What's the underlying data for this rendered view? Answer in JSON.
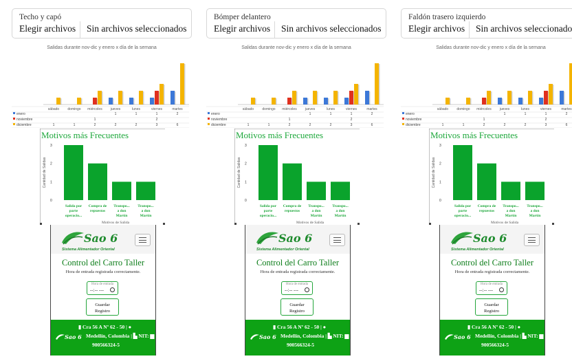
{
  "panels": [
    {
      "upload_label": "Techo y capó",
      "upload_button": "Elegir archivos",
      "upload_status": "Sin archivos seleccionados"
    },
    {
      "upload_label": "Bómper delantero",
      "upload_button": "Elegir archivos",
      "upload_status": "Sin archivos seleccionados"
    },
    {
      "upload_label": "Faldón trasero izquierdo",
      "upload_button": "Elegir archivos",
      "upload_status": "Sin archivos seleccionados"
    }
  ],
  "chart_data": [
    {
      "type": "bar",
      "title": "Salidas durante nov-dic y enero x día de la semana",
      "categories": [
        "sábado",
        "domingo",
        "miércoles",
        "jueves",
        "lunes",
        "viernes",
        "martes"
      ],
      "series": [
        {
          "name": "enero",
          "color": "#3c78d8",
          "values": [
            0,
            0,
            0,
            1,
            1,
            1,
            2
          ]
        },
        {
          "name": "noviembre",
          "color": "#e0301e",
          "values": [
            0,
            0,
            1,
            0,
            0,
            2,
            0
          ]
        },
        {
          "name": "diciembre",
          "color": "#f4b400",
          "values": [
            1,
            1,
            2,
            2,
            2,
            3,
            6
          ]
        }
      ],
      "table": [
        [
          "",
          "",
          "",
          "1",
          "1",
          "1",
          "2"
        ],
        [
          "",
          "",
          "1",
          "",
          "",
          "2",
          ""
        ],
        [
          "1",
          "1",
          "2",
          "2",
          "2",
          "3",
          "6"
        ]
      ],
      "ylim": [
        0,
        6
      ]
    },
    {
      "type": "bar",
      "title": "Motivos más Frecuentes",
      "xlabel": "Motivos de Salida",
      "ylabel": "Cantidad de Salidas",
      "categories": [
        [
          "Salida por",
          "parte",
          "operacio..."
        ],
        [
          "Compra de",
          "repuestos"
        ],
        [
          "Transpo...",
          "a don",
          "Martín"
        ],
        [
          "Transpo...",
          "a don",
          "Martín"
        ]
      ],
      "values": [
        3,
        2,
        1,
        1
      ],
      "yticks": [
        "0",
        "1",
        "2",
        "3"
      ],
      "ylim": [
        0,
        3
      ],
      "color": "#0aa32c"
    }
  ],
  "mobile": {
    "title": "Control del Carro Taller",
    "message": "Hora de entrada registrada correctamente.",
    "time_label": "Hora de entrada",
    "time_value": "--:-- ---",
    "save_line1": "Guardar",
    "save_line2": "Registro",
    "footer_line1": "Cra 56 A Nº 62 - 50 |",
    "footer_line2": "Medellín, Colombia |",
    "footer_nit": "NIT:",
    "footer_line3": "900566324-5",
    "brand_color": "#0ea215"
  }
}
